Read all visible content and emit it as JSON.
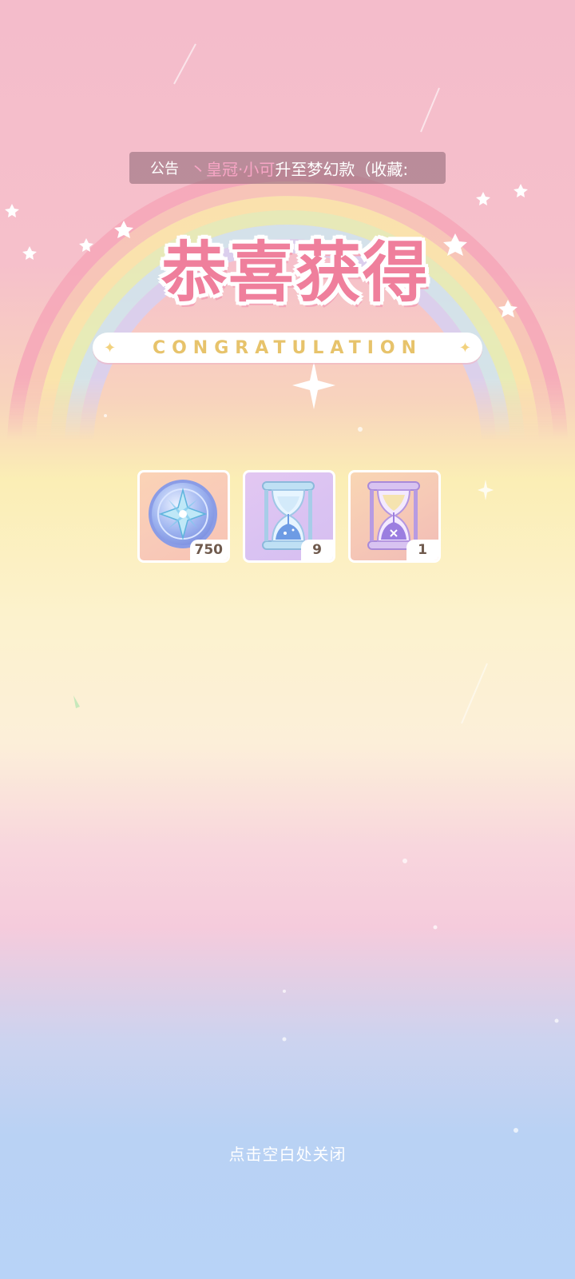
{
  "notice": {
    "tag": "公告",
    "highlight": "丶皇冠·小可",
    "text": "升至梦幻款（收藏:"
  },
  "popup": {
    "title": "恭喜获得",
    "subtitle": "CONGRATULATION",
    "close_hint": "点击空白处关闭"
  },
  "rewards": [
    {
      "icon": "star-coin-icon",
      "count": "750"
    },
    {
      "icon": "blue-hourglass-icon",
      "count": "9"
    },
    {
      "icon": "purple-hourglass-icon",
      "count": "1"
    }
  ],
  "colors": {
    "title": "#ef7f9c",
    "subtitle": "#e7c36b",
    "notice_highlight": "#f7a5c5"
  }
}
